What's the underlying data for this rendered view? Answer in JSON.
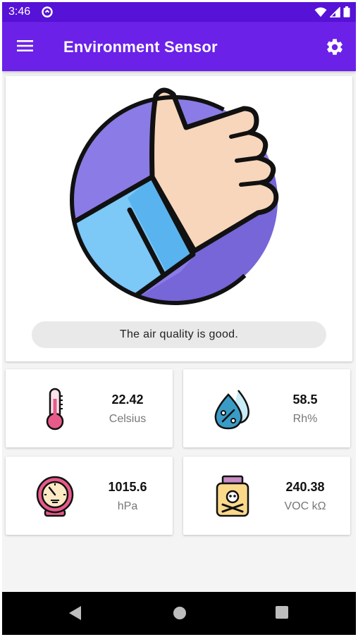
{
  "status_bar": {
    "time": "3:46"
  },
  "app_bar": {
    "title": "Environment Sensor"
  },
  "air_quality": {
    "message": "The air quality is good."
  },
  "metrics": {
    "temperature": {
      "value": "22.42",
      "unit": "Celsius",
      "icon": "thermometer-icon"
    },
    "humidity": {
      "value": "58.5",
      "unit": "Rh%",
      "icon": "water-drops-icon"
    },
    "pressure": {
      "value": "1015.6",
      "unit": "hPa",
      "icon": "barometer-icon"
    },
    "voc": {
      "value": "240.38",
      "unit": "VOC kΩ",
      "icon": "poison-jar-icon"
    }
  },
  "colors": {
    "status_bar": "#5612d6",
    "app_bar": "#6b21e8",
    "nav_bar": "#000000",
    "background": "#f4f4f4"
  }
}
